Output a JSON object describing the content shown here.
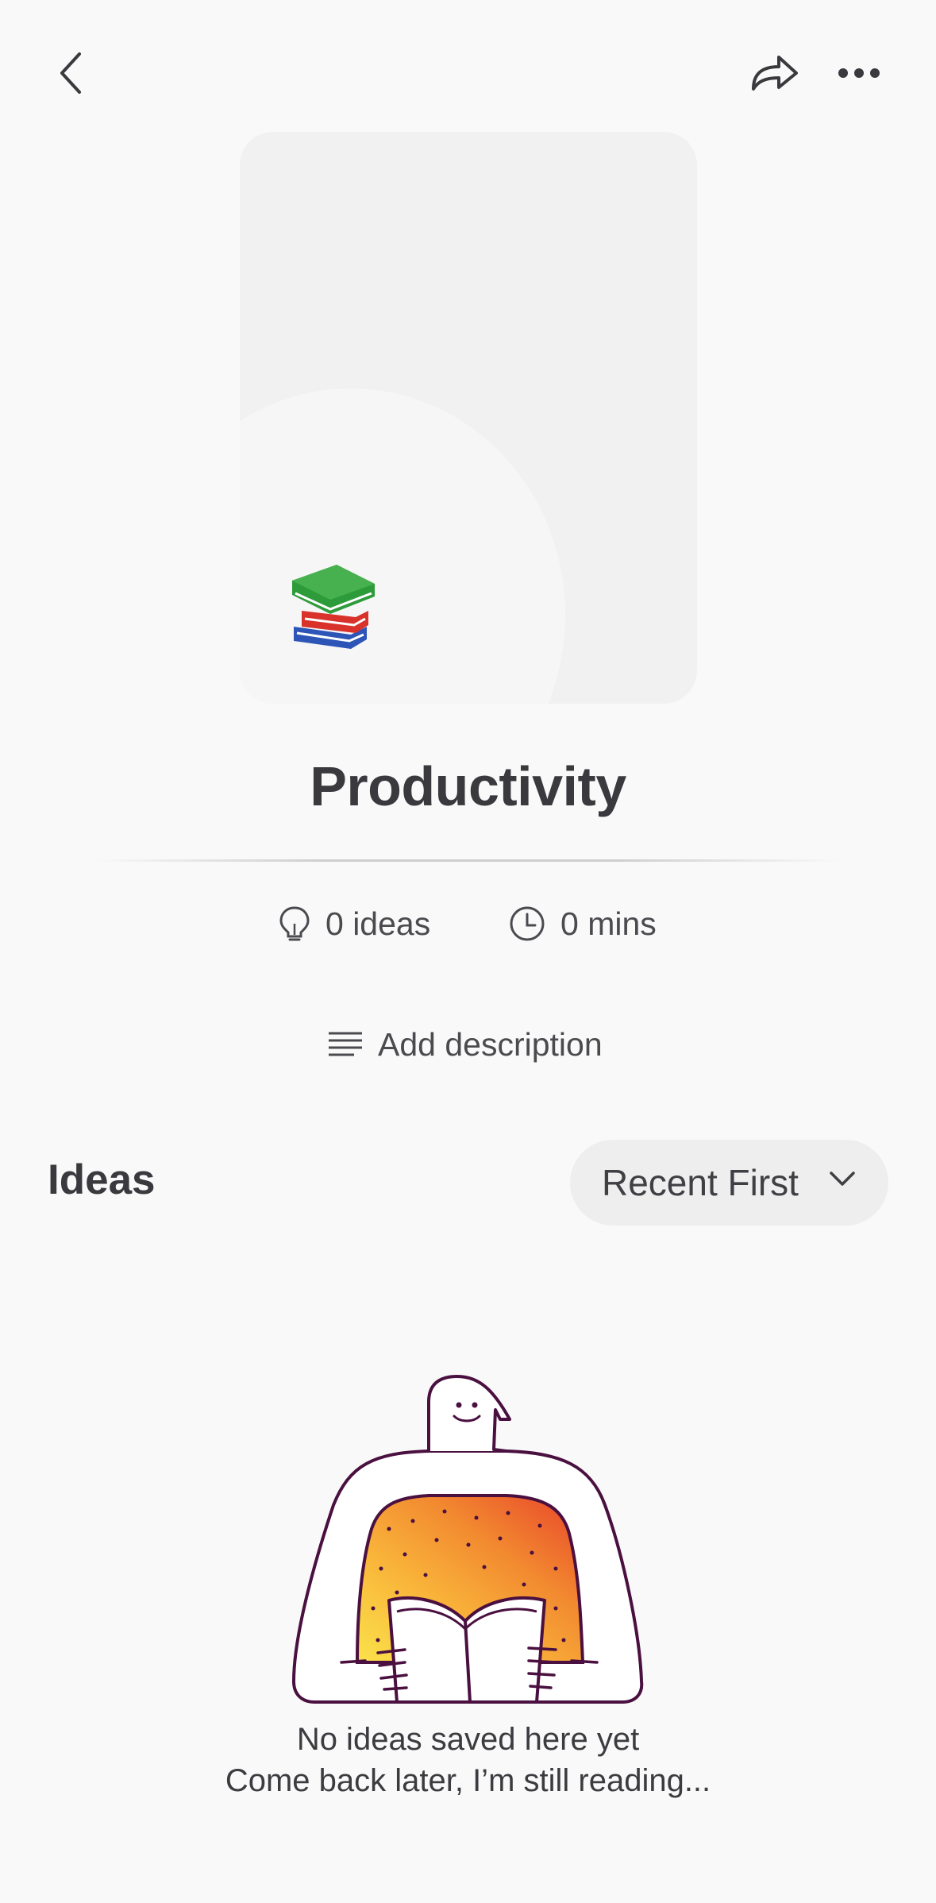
{
  "header": {
    "back_icon": "chevron-left-icon",
    "share_icon": "share-arrow-icon",
    "more_icon": "more-dots-icon"
  },
  "cover": {
    "emoji": "📚",
    "emoji_name": "books-icon",
    "background_color": "#f1f1f1"
  },
  "collection": {
    "title": "Productivity"
  },
  "stats": {
    "ideas": "0 ideas",
    "ideas_icon": "lightbulb-icon",
    "duration": "0 mins",
    "duration_icon": "clock-icon"
  },
  "description": {
    "add_label": "Add description",
    "icon": "text-lines-icon"
  },
  "ideas_section": {
    "heading": "Ideas",
    "sort_label": "Recent First",
    "sort_icon": "chevron-down-icon"
  },
  "empty_state": {
    "illustration": "reading-person-illustration",
    "line1": "No ideas saved here yet",
    "line2": "Come back later, I’m still reading..."
  },
  "colors": {
    "background": "#f9f9f9",
    "text_primary": "#3a3a3e",
    "pill_bg": "#eeeeee",
    "illustration_outline": "#4a1040"
  }
}
